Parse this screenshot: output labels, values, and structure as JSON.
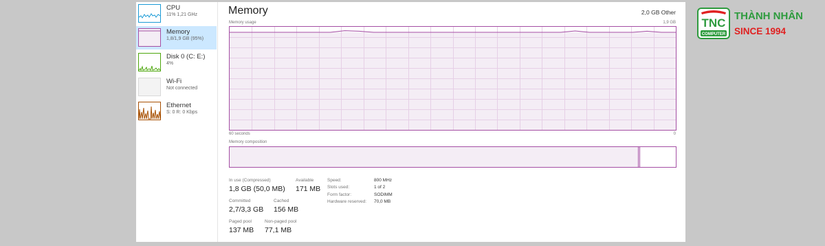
{
  "sidebar": {
    "items": [
      {
        "title": "CPU",
        "subtitle": "11% 1,21 GHz"
      },
      {
        "title": "Memory",
        "subtitle": "1,8/1,9 GB (95%)"
      },
      {
        "title": "Disk 0 (C: E:)",
        "subtitle": "4%"
      },
      {
        "title": "Wi-Fi",
        "subtitle": "Not connected"
      },
      {
        "title": "Ethernet",
        "subtitle": "S: 0 R: 0 Kbps"
      }
    ]
  },
  "panel": {
    "title": "Memory",
    "total_label": "2,0 GB Other",
    "graph_label": "Memory usage",
    "graph_max": "1,9 GB",
    "graph_time": "60 seconds",
    "graph_min": "0",
    "usage_fraction": 0.95,
    "composition_label": "Memory composition",
    "composition_in_use_fraction": 0.915,
    "composition_standby_fraction": 0.08
  },
  "stats": {
    "in_use": {
      "label": "In use (Compressed)",
      "value": "1,8 GB (50,0 MB)"
    },
    "available": {
      "label": "Available",
      "value": "171 MB"
    },
    "committed": {
      "label": "Committed",
      "value": "2,7/3,3 GB"
    },
    "cached": {
      "label": "Cached",
      "value": "156 MB"
    },
    "paged_pool": {
      "label": "Paged pool",
      "value": "137 MB"
    },
    "non_paged_pool": {
      "label": "Non-paged pool",
      "value": "77,1 MB"
    }
  },
  "details": {
    "speed": {
      "label": "Speed:",
      "value": "800 MHz"
    },
    "slots": {
      "label": "Slots used:",
      "value": "1 of 2"
    },
    "form": {
      "label": "Form factor:",
      "value": "SODIMM"
    },
    "reserved": {
      "label": "Hardware reserved:",
      "value": "70,0 MB"
    }
  },
  "brand": {
    "logo_text": "TNC",
    "logo_sub": "COMPUTER",
    "name": "THÀNH NHÂN",
    "since": "SINCE 1994"
  },
  "colors": {
    "memory_accent": "#a44ea4",
    "memory_fill": "#f4edf5",
    "cpu_accent": "#1a9ad6",
    "disk_accent": "#4da60c",
    "ethernet_accent": "#a74f01",
    "selected_bg": "#cce8ff",
    "brand_green": "#2e9b3e",
    "brand_red": "#e02020"
  }
}
